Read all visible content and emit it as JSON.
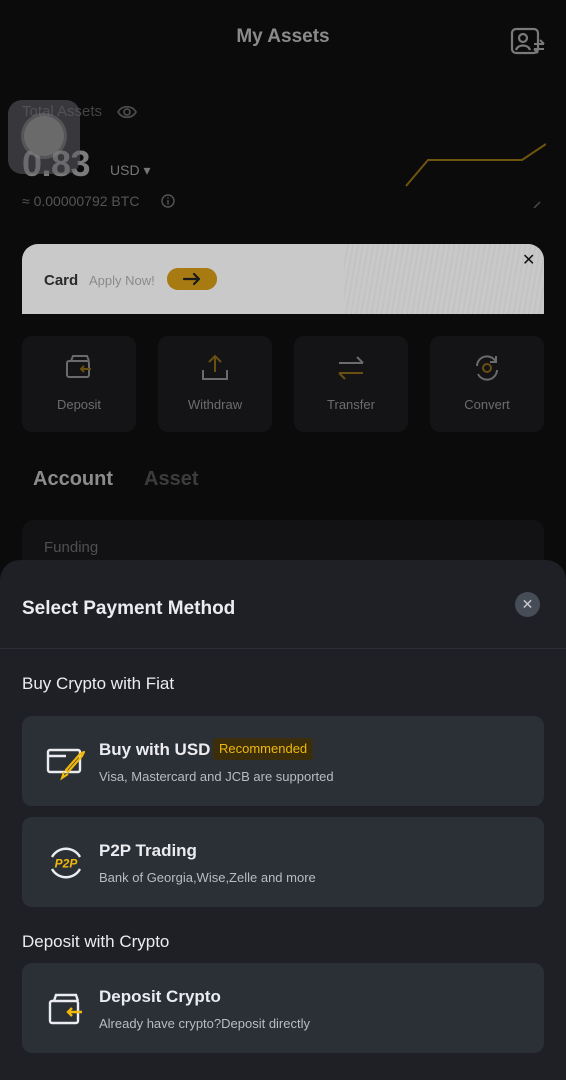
{
  "header": {
    "title": "My Assets"
  },
  "overview": {
    "total_label": "Total Assets",
    "value": "0.83",
    "currency": "USD ▾",
    "btc_equivalent": "≈ 0.00000792 BTC"
  },
  "banner": {
    "card_label": "Card",
    "apply_label": "Apply Now!",
    "close_label": "✕"
  },
  "actions": [
    {
      "label": "Deposit"
    },
    {
      "label": "Withdraw"
    },
    {
      "label": "Transfer"
    },
    {
      "label": "Convert"
    }
  ],
  "tabs": {
    "account": "Account",
    "asset": "Asset"
  },
  "funding": {
    "label": "Funding"
  },
  "sheet": {
    "title": "Select Payment Method",
    "close_label": "✕",
    "fiat_heading": "Buy Crypto with Fiat",
    "crypto_heading": "Deposit with Crypto",
    "options": [
      {
        "title": "Buy with USD",
        "badge": "Recommended",
        "subtitle": "Visa, Mastercard and JCB are supported",
        "icon": "card-rocket-icon"
      },
      {
        "title": "P2P Trading",
        "subtitle": "Bank of Georgia,Wise,Zelle and more",
        "icon": "p2p-icon"
      },
      {
        "title": "Deposit Crypto",
        "subtitle": "Already have crypto?Deposit directly",
        "icon": "wallet-deposit-icon"
      }
    ]
  },
  "colors": {
    "accent": "#f0b90b",
    "sheet_bg": "#1e2026",
    "option_bg": "#2b2f36"
  }
}
